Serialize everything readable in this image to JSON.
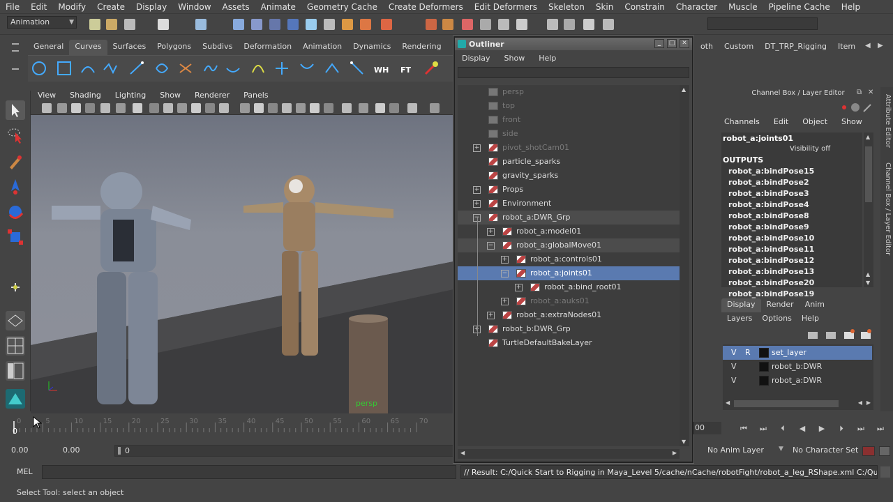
{
  "menubar": {
    "items": [
      "File",
      "Edit",
      "Modify",
      "Create",
      "Display",
      "Window",
      "Assets",
      "Animate",
      "Geometry Cache",
      "Create Deformers",
      "Edit Deformers",
      "Skeleton",
      "Skin",
      "Constrain",
      "Character",
      "Muscle",
      "Pipeline Cache",
      "Help"
    ]
  },
  "toolbar": {
    "mode": "Animation"
  },
  "shelf": {
    "tabs": [
      "General",
      "Curves",
      "Surfaces",
      "Polygons",
      "Subdivs",
      "Deformation",
      "Animation",
      "Dynamics",
      "Rendering"
    ],
    "active": "Curves",
    "right_tabs": [
      "oth",
      "Custom",
      "DT_TRP_Rigging",
      "Item"
    ],
    "wh_label": "WH",
    "ft_label": "FT"
  },
  "viewport": {
    "menu": [
      "View",
      "Shading",
      "Lighting",
      "Show",
      "Renderer",
      "Panels"
    ],
    "camera_label": "persp"
  },
  "timeline": {
    "ticks": [
      "0",
      "5",
      "10",
      "15",
      "20",
      "25",
      "30",
      "35",
      "40",
      "45",
      "50",
      "55",
      "60",
      "65",
      "70"
    ],
    "current": "0",
    "start": "0.00",
    "range_start": "0.00",
    "range_field": "0",
    "end_field": "00"
  },
  "outliner": {
    "title": "Outliner",
    "menu": [
      "Display",
      "Show",
      "Help"
    ],
    "rows": [
      {
        "label": "persp",
        "indent": 0,
        "dim": true,
        "exp": ""
      },
      {
        "label": "top",
        "indent": 0,
        "dim": true,
        "exp": ""
      },
      {
        "label": "front",
        "indent": 0,
        "dim": true,
        "exp": ""
      },
      {
        "label": "side",
        "indent": 0,
        "dim": true,
        "exp": ""
      },
      {
        "label": "pivot_shotCam01",
        "indent": 0,
        "dim": true,
        "exp": "+"
      },
      {
        "label": "particle_sparks",
        "indent": 0,
        "dim": false,
        "exp": ""
      },
      {
        "label": "gravity_sparks",
        "indent": 0,
        "dim": false,
        "exp": ""
      },
      {
        "label": "Props",
        "indent": 0,
        "dim": false,
        "exp": "+"
      },
      {
        "label": "Environment",
        "indent": 0,
        "dim": false,
        "exp": "+"
      },
      {
        "label": "robot_a:DWR_Grp",
        "indent": 0,
        "dim": false,
        "exp": "−",
        "hl": true
      },
      {
        "label": "robot_a:model01",
        "indent": 1,
        "dim": false,
        "exp": "+"
      },
      {
        "label": "robot_a:globalMove01",
        "indent": 1,
        "dim": false,
        "exp": "−",
        "hl": true
      },
      {
        "label": "robot_a:controls01",
        "indent": 2,
        "dim": false,
        "exp": "+"
      },
      {
        "label": "robot_a:joints01",
        "indent": 2,
        "dim": false,
        "exp": "−",
        "sel": true
      },
      {
        "label": "robot_a:bind_root01",
        "indent": 3,
        "dim": false,
        "exp": "+"
      },
      {
        "label": "robot_a:auks01",
        "indent": 2,
        "dim": true,
        "exp": "+"
      },
      {
        "label": "robot_a:extraNodes01",
        "indent": 1,
        "dim": false,
        "exp": "+"
      },
      {
        "label": "robot_b:DWR_Grp",
        "indent": 0,
        "dim": false,
        "exp": "+"
      },
      {
        "label": "TurtleDefaultBakeLayer",
        "indent": 0,
        "dim": false,
        "exp": ""
      }
    ]
  },
  "channelbox": {
    "header": "Channel Box / Layer Editor",
    "menu": [
      "Channels",
      "Edit",
      "Object",
      "Show"
    ],
    "object": "robot_a:joints01",
    "visibility": "Visibility off",
    "outputs_label": "OUTPUTS",
    "outputs": [
      "robot_a:bindPose15",
      "robot_a:bindPose2",
      "robot_a:bindPose3",
      "robot_a:bindPose4",
      "robot_a:bindPose8",
      "robot_a:bindPose9",
      "robot_a:bindPose10",
      "robot_a:bindPose11",
      "robot_a:bindPose12",
      "robot_a:bindPose13",
      "robot_a:bindPose20",
      "robot_a:bindPose19"
    ]
  },
  "layers": {
    "tabs": [
      "Display",
      "Render",
      "Anim"
    ],
    "active": "Display",
    "menu": [
      "Layers",
      "Options",
      "Help"
    ],
    "items": [
      {
        "v": "V",
        "r": "R",
        "name": "set_layer",
        "sel": true
      },
      {
        "v": "V",
        "r": "",
        "name": "robot_b:DWR",
        "sel": false
      },
      {
        "v": "V",
        "r": "",
        "name": "robot_a:DWR",
        "sel": false
      }
    ]
  },
  "side_tabs": [
    "Attribute Editor",
    "Channel Box / Layer Editor"
  ],
  "status": {
    "anim_layer": "No Anim Layer",
    "char_set": "No Character Set"
  },
  "cmdline": {
    "lang": "MEL",
    "result": "// Result: C:/Quick Start to Rigging in Maya_Level 5/cache/nCache/robotFight/robot_a_leg_RShape.xml C:/Quick Start to R"
  },
  "help": {
    "text": "Select Tool: select an object"
  }
}
